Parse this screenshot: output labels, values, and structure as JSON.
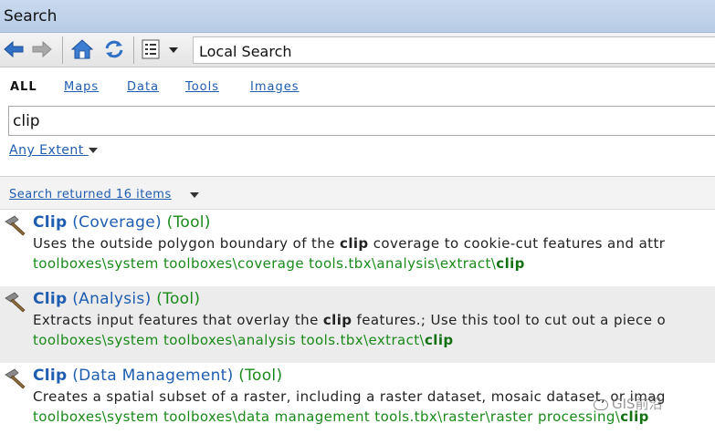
{
  "window": {
    "title": "Search"
  },
  "toolbar": {
    "back_icon": "arrow-left-icon",
    "forward_icon": "arrow-right-icon",
    "home_icon": "home-icon",
    "refresh_icon": "refresh-icon",
    "options_icon": "list-options-icon",
    "location_text": "Local Search"
  },
  "tabs": [
    {
      "label": "ALL",
      "active": true
    },
    {
      "label": "Maps",
      "active": false
    },
    {
      "label": "Data",
      "active": false
    },
    {
      "label": "Tools",
      "active": false
    },
    {
      "label": "Images",
      "active": false
    }
  ],
  "search": {
    "value": "clip"
  },
  "extent": {
    "label": "Any Extent"
  },
  "results": {
    "summary": "Search returned 16 items",
    "items": [
      {
        "name": "Clip",
        "subtitle": "(Coverage)",
        "kind": "(Tool)",
        "desc_before": "Uses the outside polygon boundary of the ",
        "desc_highlight": "clip",
        "desc_after": " coverage to cookie-cut features and attr",
        "path": "toolboxes\\system toolboxes\\coverage tools.tbx\\analysis\\extract\\",
        "path_highlight": "clip"
      },
      {
        "name": "Clip",
        "subtitle": "(Analysis)",
        "kind": "(Tool)",
        "desc_before": "Extracts input features that overlay the ",
        "desc_highlight": "clip",
        "desc_after": " features.; Use this tool to cut out a piece o",
        "path": "toolboxes\\system toolboxes\\analysis tools.tbx\\extract\\",
        "path_highlight": "clip"
      },
      {
        "name": "Clip",
        "subtitle": "(Data Management)",
        "kind": "(Tool)",
        "desc_before": "Creates a spatial subset of a raster, including a raster dataset, mosaic dataset, or imag",
        "desc_highlight": "",
        "desc_after": "",
        "path": "toolboxes\\system toolboxes\\data management tools.tbx\\raster\\raster processing\\",
        "path_highlight": "clip"
      }
    ]
  },
  "watermark": {
    "text": "GIS前沿"
  },
  "colors": {
    "link": "#1f5db0",
    "path_green": "#1a8a1a",
    "titlebar": "#c2d5ec"
  }
}
